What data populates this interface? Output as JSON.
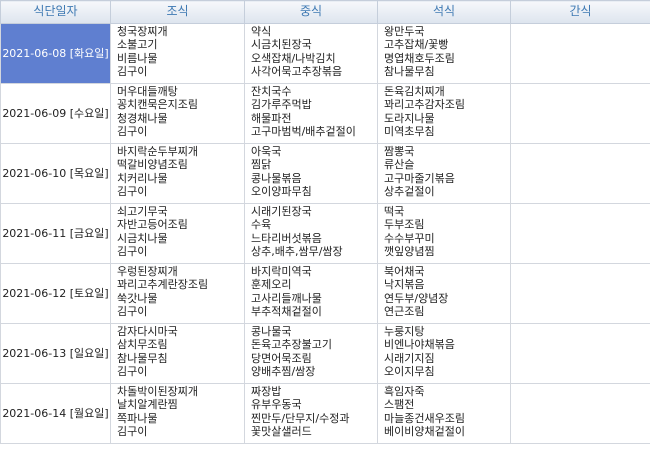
{
  "headers": {
    "date": "식단일자",
    "breakfast": "조식",
    "lunch": "중식",
    "dinner": "석식",
    "snack": "간식"
  },
  "rows": [
    {
      "date": "2021-06-08 [화요일]",
      "selected": true,
      "breakfast": [
        "청국장찌개",
        "소불고기",
        "비름나물",
        "김구이"
      ],
      "lunch": [
        "약식",
        "시금치된장국",
        "오색잡채/나박김치",
        "사각어묵고추장볶음"
      ],
      "dinner": [
        "왕만두국",
        "고추잡채/꽃빵",
        "명엽채호두조림",
        "참나물무침"
      ],
      "snack": []
    },
    {
      "date": "2021-06-09 [수요일]",
      "selected": false,
      "breakfast": [
        "머우대들깨탕",
        "꽁치캔묵은지조림",
        "청경채나물",
        "김구이"
      ],
      "lunch": [
        "잔치국수",
        "김가루주먹밥",
        "해물파전",
        "고구마범벅/배추겉절이"
      ],
      "dinner": [
        "돈육김치찌개",
        "꽈리고추감자조림",
        "도라지나물",
        "미역초무침"
      ],
      "snack": []
    },
    {
      "date": "2021-06-10 [목요일]",
      "selected": false,
      "breakfast": [
        "바지락순두부찌개",
        "떡갈비양념조림",
        "치커리나물",
        "김구이"
      ],
      "lunch": [
        "아욱국",
        "찜닭",
        "콩나물볶음",
        "오이양파무침"
      ],
      "dinner": [
        "짬뽕국",
        "류산슬",
        "고구마줄기볶음",
        "상추겉절이"
      ],
      "snack": []
    },
    {
      "date": "2021-06-11 [금요일]",
      "selected": false,
      "breakfast": [
        "쇠고기무국",
        "자반고등어조림",
        "시금치나물",
        "김구이"
      ],
      "lunch": [
        "시래기된장국",
        "수육",
        "느타리버섯볶음",
        "상추,배추,쌈무/쌈장"
      ],
      "dinner": [
        "떡국",
        "두부조림",
        "수수부꾸미",
        "깻잎양념찜"
      ],
      "snack": []
    },
    {
      "date": "2021-06-12 [토요일]",
      "selected": false,
      "breakfast": [
        "우렁된장찌개",
        "꽈리고추계란장조림",
        "쑥갓나물",
        "김구이"
      ],
      "lunch": [
        "바지락미역국",
        "훈제오리",
        "고사리들깨나물",
        "부추적채겉절이"
      ],
      "dinner": [
        "북어채국",
        "낙지볶음",
        "연두부/양념장",
        "연근조림"
      ],
      "snack": []
    },
    {
      "date": "2021-06-13 [일요일]",
      "selected": false,
      "breakfast": [
        "감자다시마국",
        "삼치무조림",
        "참나물무침",
        "김구이"
      ],
      "lunch": [
        "콩나물국",
        "돈육고추장불고기",
        "당면어묵조림",
        "양배추찜/쌈장"
      ],
      "dinner": [
        "누룽지탕",
        "비엔나야채볶음",
        "시래기지짐",
        "오이지무침"
      ],
      "snack": []
    },
    {
      "date": "2021-06-14 [월요일]",
      "selected": false,
      "breakfast": [
        "차돌박이된장찌개",
        "날치알계란찜",
        "쪽파나물",
        "김구이"
      ],
      "lunch": [
        "짜장밥",
        "유부우동국",
        "찐만두/단무지/수정과",
        "꽃맛살샐러드"
      ],
      "dinner": [
        "흑임자죽",
        "스팸전",
        "마늘종건새우조림",
        "베이비양채겉절이"
      ],
      "snack": []
    }
  ]
}
